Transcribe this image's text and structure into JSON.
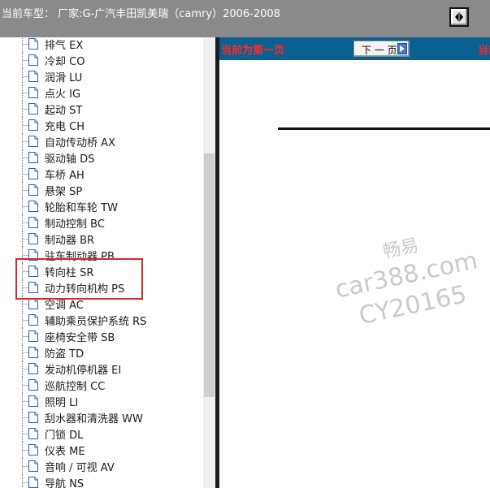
{
  "header": {
    "title": "当前车型： 厂家:G-广汽丰田凯美瑞（camry）2006-2008",
    "toggle_icon": "diamond-toggle-icon"
  },
  "sidebar": {
    "items": [
      {
        "label": "排气 EX"
      },
      {
        "label": "冷却 CO"
      },
      {
        "label": "润滑 LU"
      },
      {
        "label": "点火 IG"
      },
      {
        "label": "起动 ST"
      },
      {
        "label": "充电 CH"
      },
      {
        "label": "自动传动桥 AX"
      },
      {
        "label": "驱动轴 DS"
      },
      {
        "label": "车桥 AH"
      },
      {
        "label": "悬架 SP"
      },
      {
        "label": "轮胎和车轮 TW"
      },
      {
        "label": "制动控制 BC"
      },
      {
        "label": "制动器 BR"
      },
      {
        "label": "驻车制动器 PB"
      },
      {
        "label": "转向柱 SR"
      },
      {
        "label": "动力转向机构 PS"
      },
      {
        "label": "空调 AC"
      },
      {
        "label": "辅助乘员保护系统 RS"
      },
      {
        "label": "座椅安全带 SB"
      },
      {
        "label": "防盗 TD"
      },
      {
        "label": "发动机停机器 EI"
      },
      {
        "label": "巡航控制 CC"
      },
      {
        "label": "照明 LI"
      },
      {
        "label": "刮水器和清洗器 WW"
      },
      {
        "label": "门锁 DL"
      },
      {
        "label": "仪表 ME"
      },
      {
        "label": "音响 / 可视 AV"
      },
      {
        "label": "导航 NS"
      }
    ],
    "item_icon": "document-icon"
  },
  "main": {
    "nav": {
      "first_page_text": "当前为第一页",
      "next_button_label": "下 一 页",
      "current_text": "当前"
    }
  },
  "watermark": {
    "line1": "畅易",
    "line2": "car388.com",
    "line3": "CY20165"
  },
  "colors": {
    "header_bg": "#8a8a8a",
    "nav_bar_bg": "#0a6190",
    "nav_text": "#ff2a2a",
    "highlight_border": "#d52a2a"
  }
}
